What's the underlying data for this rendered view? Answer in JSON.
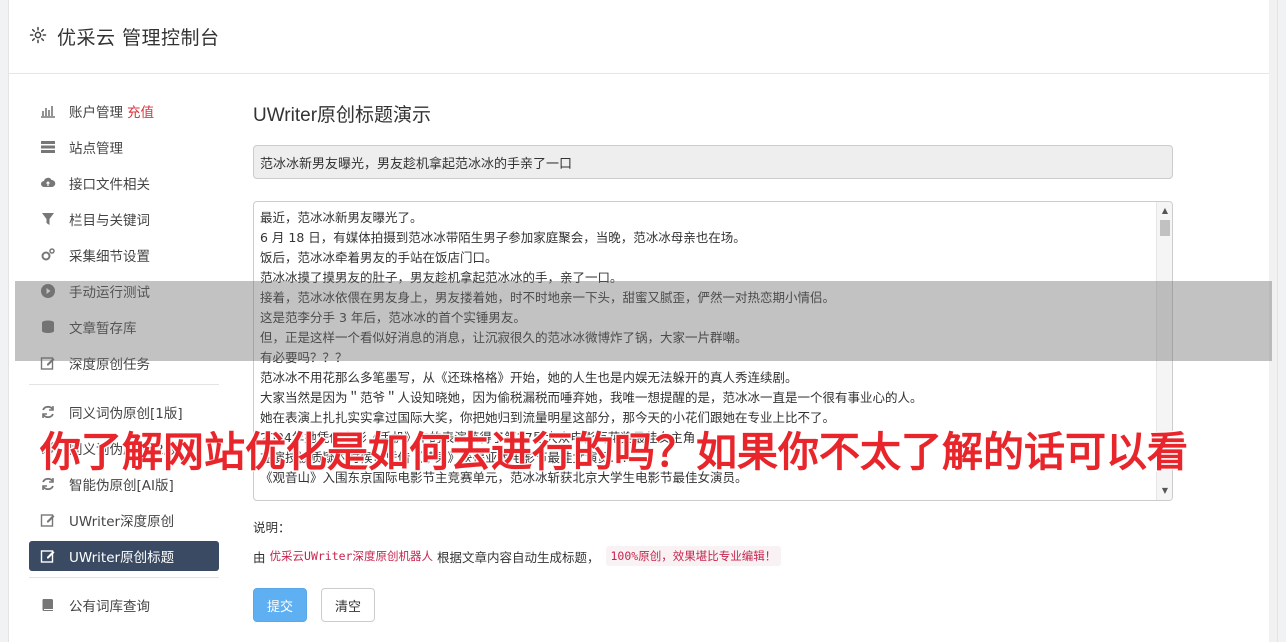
{
  "header": {
    "brand": "优采云 管理控制台",
    "icon": "gear-icon"
  },
  "sidebar": {
    "items": [
      {
        "label": "账户管理",
        "accent": "充值",
        "icon": "bar-chart-icon"
      },
      {
        "label": "站点管理",
        "icon": "server-icon"
      },
      {
        "label": "接口文件相关",
        "icon": "cloud-upload-icon"
      },
      {
        "label": "栏目与关键词",
        "icon": "filter-icon"
      },
      {
        "label": "采集细节设置",
        "icon": "cogs-icon"
      },
      {
        "label": "手动运行测试",
        "icon": "play-circle-icon"
      },
      {
        "label": "文章暂存库",
        "icon": "database-icon"
      },
      {
        "label": "深度原创任务",
        "icon": "edit-icon"
      }
    ],
    "items2": [
      {
        "label": "同义词伪原创[1版]",
        "icon": "refresh-icon"
      },
      {
        "label": "同义词伪原创[2版]",
        "icon": "refresh-icon"
      },
      {
        "label": "智能伪原创[AI版]",
        "icon": "refresh-icon"
      },
      {
        "label": "UWriter深度原创",
        "icon": "edit-icon"
      },
      {
        "label": "UWriter原创标题",
        "icon": "edit-icon",
        "active": true
      }
    ],
    "items3": [
      {
        "label": "公有词库查询",
        "icon": "book-icon"
      }
    ]
  },
  "main": {
    "title": "UWriter原创标题演示",
    "title_value": "范冰冰新男友曝光，男友趁机拿起范冰冰的手亲了一口",
    "content_lines": [
      "最近，范冰冰新男友曝光了。",
      "6 月 18 日，有媒体拍摄到范冰冰带陌生男子参加家庭聚会，当晚，范冰冰母亲也在场。",
      "饭后，范冰冰牵着男友的手站在饭店门口。",
      "范冰冰摸了摸男友的肚子，男友趁机拿起范冰冰的手，亲了一口。",
      "接着，范冰冰依偎在男友身上，男友搂着她，时不时地亲一下头，甜蜜又腻歪，俨然一对热恋期小情侣。",
      "这是范李分手 3 年后，范冰冰的首个实锤男友。",
      "但，正是这样一个看似好消息的消息，让沉寂很久的范冰冰微博炸了锅，大家一片群嘲。",
      "有必要吗？？？",
      "范冰冰不用花那么多笔墨写，从《还珠格格》开始，她的人生也是内娱无法躲开的真人秀连续剧。",
      "大家当然是因为＂范爷＂人设知晓她，因为偷税漏税而唾弃她，我唯一想提醒的是，范冰冰一直是一个很有事业心的人。",
      "她在表演上扎扎实实拿过国际大奖，你把她归到流量明星这部分，那今天的小花们跟她在专业上比不了。",
      "2004年她凭借电影《手机》中的表演获得了第27届大众电影百花奖最佳女主角……",
      "在演技被质疑的时候，凭借《苹果》获得亚太电影节最佳女演员……",
      "《观音山》入围东京国际电影节主竞赛单元，范冰冰斩获北京大学生电影节最佳女演员。"
    ],
    "note_label": "说明：",
    "note_prefix": "由",
    "note_code": "优采云UWriter深度原创机器人",
    "note_mid": "根据文章内容自动生成标题，",
    "note_pill": "100%原创，效果堪比专业编辑！",
    "submit_label": "提交",
    "clear_label": "清空"
  },
  "overlay": {
    "caption": "你了解网站优化是如何去进行的吗？如果你不太了解的话可以看"
  },
  "colors": {
    "active_nav": "#3a4a63",
    "accent_red": "#d9363e",
    "primary_button": "#5fb0f3",
    "caption_red": "#e8252a"
  }
}
